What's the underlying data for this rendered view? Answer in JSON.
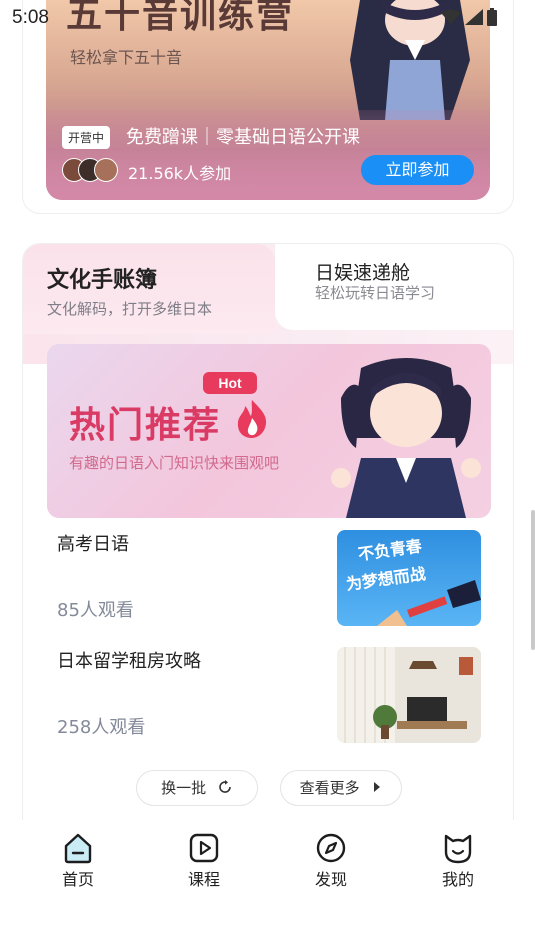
{
  "status_bar": {
    "time": "5:08"
  },
  "camp": {
    "title": "五十音训练营",
    "subtitle": "轻松拿下五十音",
    "badge": "开营中",
    "course": "免费蹭课｜零基础日语公开课",
    "participants": "21.56k人参加",
    "join_label": "立即参加"
  },
  "culture": {
    "tab_active": {
      "title": "文化手账簿",
      "subtitle": "文化解码，打开多维日本"
    },
    "tab_other": {
      "title": "日娱速递舱",
      "subtitle": "轻松玩转日语学习"
    },
    "hot_banner": {
      "tag": "Hot",
      "title": "热门推荐",
      "subtitle": "有趣的日语入门知识快来围观吧"
    },
    "articles": [
      {
        "title": "高考日语",
        "views": "85人观看",
        "thumb_text": "不负青春 为梦想而战"
      },
      {
        "title": "日本留学租房攻略",
        "views": "258人观看"
      }
    ],
    "refresh_label": "换一批",
    "more_label": "查看更多"
  },
  "bottom_nav": {
    "items": [
      {
        "label": "首页",
        "icon": "home-icon"
      },
      {
        "label": "课程",
        "icon": "play-icon"
      },
      {
        "label": "发现",
        "icon": "compass-icon"
      },
      {
        "label": "我的",
        "icon": "cat-icon"
      }
    ]
  },
  "colors": {
    "accent_blue": "#1a8ff6",
    "hot_red": "#e83a5d",
    "hot_pink": "#d93b64"
  }
}
